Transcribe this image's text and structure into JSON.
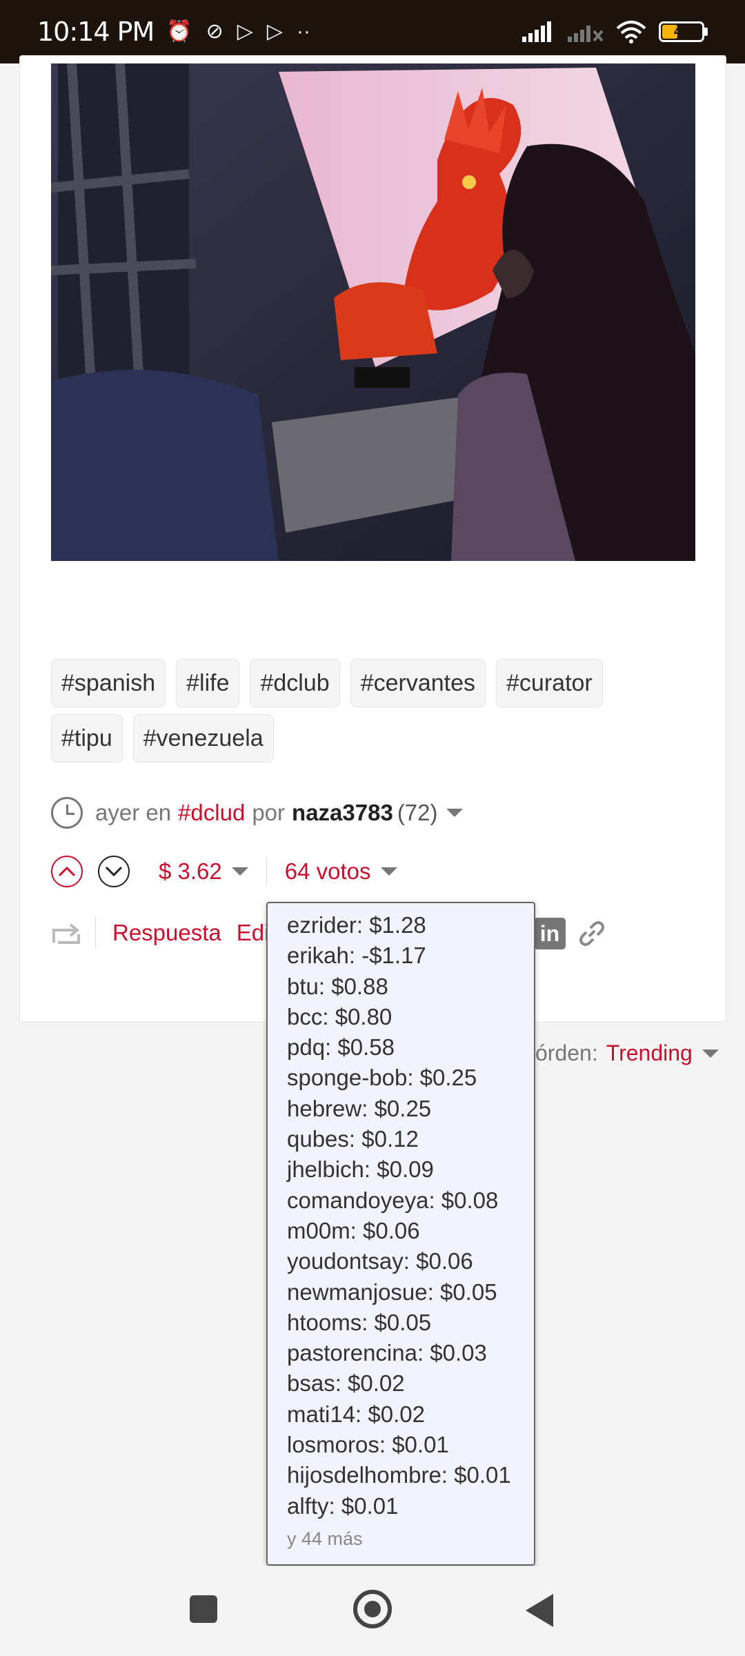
{
  "status_bar": {
    "time": "10:14 PM",
    "battery": "43",
    "battery_level": 0.43,
    "left_icons": [
      "alarm-icon",
      "mute-icon",
      "play-icon",
      "play-icon",
      "more-dots-icon"
    ],
    "right_icons": [
      "signal-icon",
      "signal-nosim-icon",
      "wifi-icon",
      "battery-icon"
    ]
  },
  "post": {
    "image_alt": "",
    "tags": [
      "#spanish",
      "#life",
      "#dclub",
      "#cervantes",
      "#curator",
      "#tipu",
      "#venezuela"
    ],
    "meta": {
      "time": "ayer en",
      "community": "#dclud",
      "por": "por",
      "author": "naza3783",
      "reputation": "(72)"
    },
    "payout": "$ 3.62",
    "votes_label": "64 votos",
    "reply_label": "Respuesta",
    "edit_label": "Edi"
  },
  "sort": {
    "label": "órden:",
    "value": "Trending"
  },
  "vote_list": {
    "voters": [
      "ezrider: $1.28",
      "erikah: -$1.17",
      "btu: $0.88",
      "bcc: $0.80",
      "pdq: $0.58",
      "sponge-bob: $0.25",
      "hebrew: $0.25",
      "qubes: $0.12",
      "jhelbich: $0.09",
      "comandoyeya: $0.08",
      "m00m: $0.06",
      "youdontsay: $0.06",
      "newmanjosue: $0.05",
      "htooms: $0.05",
      "pastorencina: $0.03",
      "bsas: $0.02",
      "mati14: $0.02",
      "losmoros: $0.01",
      "hijosdelhombre: $0.01",
      "alfty: $0.01"
    ],
    "more": "y 44 más"
  },
  "colors": {
    "accent": "#c8102e",
    "status_bar": "#1d130d",
    "dropdown_bg": "#f2f3fc"
  }
}
